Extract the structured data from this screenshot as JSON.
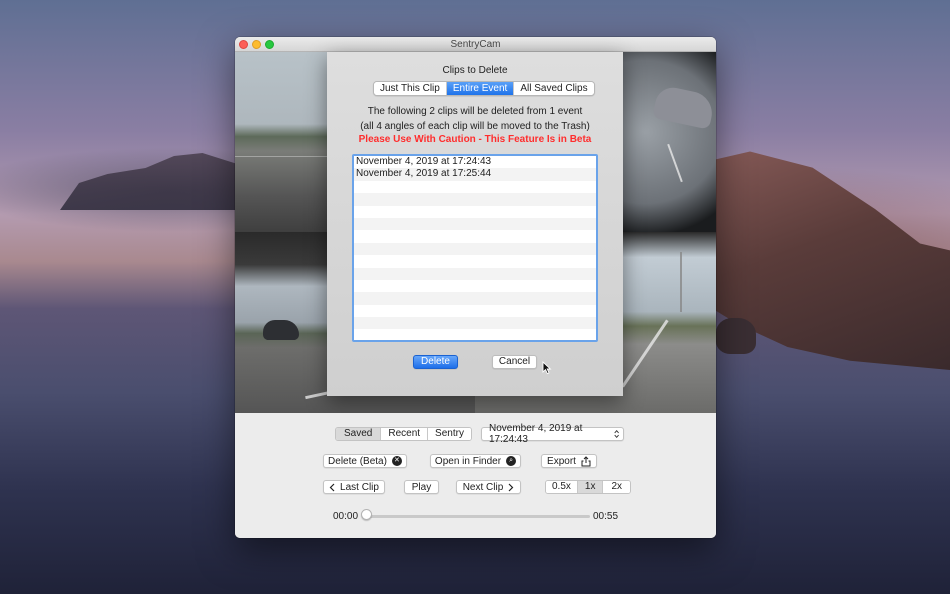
{
  "window": {
    "title": "SentryCam"
  },
  "dialog": {
    "title": "Clips to Delete",
    "scope_options": [
      {
        "label": "Just This Clip",
        "selected": false
      },
      {
        "label": "Entire Event",
        "selected": true
      },
      {
        "label": "All Saved Clips",
        "selected": false
      }
    ],
    "info_line1": "The following 2 clips will be deleted from 1 event",
    "info_line2": "(all 4 angles of each clip will be moved to the Trash)",
    "warning": "Please Use With Caution - This Feature Is in Beta",
    "clips": [
      "November 4, 2019 at 17:24:43",
      "November 4, 2019 at 17:25:44"
    ],
    "delete_label": "Delete",
    "cancel_label": "Cancel"
  },
  "controls": {
    "source_tabs": [
      {
        "label": "Saved",
        "selected": true
      },
      {
        "label": "Recent",
        "selected": false
      },
      {
        "label": "Sentry",
        "selected": false
      }
    ],
    "event_select": "November 4, 2019 at 17:24:43",
    "delete_label": "Delete (Beta)",
    "open_finder_label": "Open in Finder",
    "export_label": "Export",
    "last_clip_label": "Last Clip",
    "play_label": "Play",
    "next_clip_label": "Next Clip",
    "speeds": [
      {
        "label": "0.5x",
        "selected": false
      },
      {
        "label": "1x",
        "selected": true
      },
      {
        "label": "2x",
        "selected": false
      }
    ],
    "time_start": "00:00",
    "time_end": "00:55",
    "playback_progress": 0.02
  },
  "colors": {
    "accent": "#1e6fe9",
    "warning": "#ff2d2d",
    "list_border": "#6aa3ea"
  }
}
